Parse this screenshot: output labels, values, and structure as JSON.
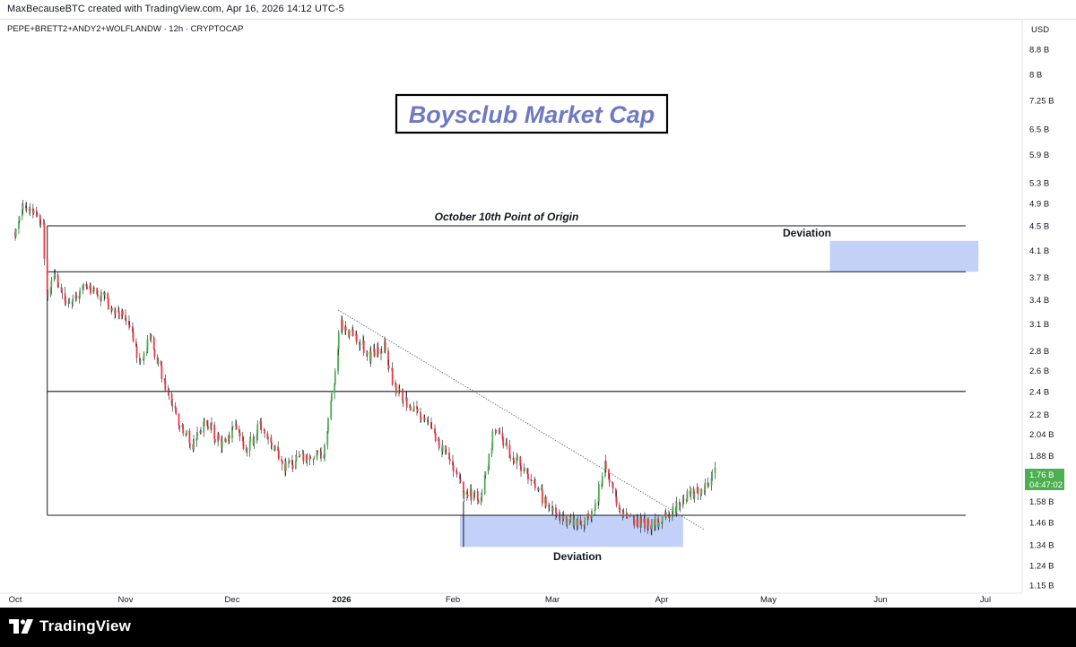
{
  "header": {
    "credit": "MaxBecauseBTC created with TradingView.com, Apr 16, 2026 14:12 UTC-5"
  },
  "chart": {
    "symbol_line": "PEPE+BRETT2+ANDY2+WOLFLANDW · 12h · CRYPTOCAP",
    "title": "Boysclub Market Cap",
    "annotation_origin": "October 10th Point of Origin",
    "annotation_deviation_top": "Deviation",
    "annotation_deviation_bottom": "Deviation",
    "currency": "USD",
    "price_badge": "1.76 B",
    "countdown": "04:47:02",
    "colors": {
      "up": "#4caf50",
      "down": "#f23645",
      "badge": "#4caf50",
      "deviation_box": "#b8c9f8",
      "title_text": "#6e79c2"
    }
  },
  "footer": {
    "brand": "TradingView"
  },
  "chart_data": {
    "type": "candlestick",
    "scale": "log",
    "y_axis_label": "USD",
    "y_tick_labels": [
      "8.8 B",
      "8 B",
      "7.25 B",
      "6.5 B",
      "5.9 B",
      "5.3 B",
      "4.9 B",
      "4.5 B",
      "4.1 B",
      "3.7 B",
      "3.4 B",
      "3.1 B",
      "2.8 B",
      "2.6 B",
      "2.4 B",
      "2.2 B",
      "2.04 B",
      "1.88 B",
      "1.58 B",
      "1.46 B",
      "1.34 B",
      "1.24 B",
      "1.15 B"
    ],
    "y_tick_values": [
      8.8,
      8.0,
      7.25,
      6.5,
      5.9,
      5.3,
      4.9,
      4.5,
      4.1,
      3.7,
      3.4,
      3.1,
      2.8,
      2.6,
      2.4,
      2.2,
      2.04,
      1.88,
      1.58,
      1.46,
      1.34,
      1.24,
      1.15
    ],
    "x_tick_labels": [
      "Oct",
      "Nov",
      "Dec",
      "2026",
      "Feb",
      "Mar",
      "Apr",
      "May",
      "Jun",
      "Jul"
    ],
    "x_tick_dates": [
      "2025-10-01",
      "2025-11-01",
      "2025-12-01",
      "2026-01-01",
      "2026-02-01",
      "2026-03-01",
      "2026-04-01",
      "2026-05-01",
      "2026-06-01",
      "2026-07-01"
    ],
    "ylim": [
      1.14,
      9.3
    ],
    "last_price": 1.76,
    "horizontal_levels": [
      {
        "value": 4.5,
        "from": "2025-10-10"
      },
      {
        "value": 3.78,
        "from": "2025-10-10"
      },
      {
        "value": 2.4,
        "from": "2025-10-10"
      },
      {
        "value": 1.5,
        "from": "2025-10-10"
      }
    ],
    "trendline": {
      "from": {
        "date": "2025-12-31",
        "value": 3.27
      },
      "to": {
        "date": "2026-04-13",
        "value": 1.42
      }
    },
    "deviation_zones": [
      {
        "from": "2026-05-18",
        "to": "2026-06-29",
        "low": 3.78,
        "high": 4.25
      },
      {
        "from": "2026-02-03",
        "to": "2026-04-07",
        "low": 1.33,
        "high": 1.5
      }
    ],
    "close_path": [
      [
        "2025-10-01",
        4.4
      ],
      [
        "2025-10-03",
        4.75
      ],
      [
        "2025-10-05",
        4.85
      ],
      [
        "2025-10-07",
        4.65
      ],
      [
        "2025-10-09",
        4.55
      ],
      [
        "2025-10-10",
        3.4
      ],
      [
        "2025-10-12",
        3.75
      ],
      [
        "2025-10-16",
        3.3
      ],
      [
        "2025-10-20",
        3.55
      ],
      [
        "2025-10-26",
        3.45
      ],
      [
        "2025-10-29",
        3.25
      ],
      [
        "2025-11-02",
        3.15
      ],
      [
        "2025-11-05",
        2.65
      ],
      [
        "2025-11-08",
        2.95
      ],
      [
        "2025-11-12",
        2.5
      ],
      [
        "2025-11-16",
        2.15
      ],
      [
        "2025-11-20",
        1.95
      ],
      [
        "2025-11-24",
        2.15
      ],
      [
        "2025-11-28",
        1.95
      ],
      [
        "2025-12-02",
        2.1
      ],
      [
        "2025-12-05",
        1.92
      ],
      [
        "2025-12-09",
        2.1
      ],
      [
        "2025-12-13",
        1.95
      ],
      [
        "2025-12-16",
        1.8
      ],
      [
        "2025-12-20",
        1.85
      ],
      [
        "2025-12-27",
        1.9
      ],
      [
        "2025-12-30",
        2.5
      ],
      [
        "2026-01-01",
        3.1
      ],
      [
        "2026-01-05",
        2.95
      ],
      [
        "2026-01-09",
        2.75
      ],
      [
        "2026-01-13",
        2.85
      ],
      [
        "2026-01-16",
        2.45
      ],
      [
        "2026-01-20",
        2.25
      ],
      [
        "2026-01-24",
        2.2
      ],
      [
        "2026-01-28",
        2.0
      ],
      [
        "2026-02-01",
        1.82
      ],
      [
        "2026-02-04",
        1.65
      ],
      [
        "2026-02-09",
        1.6
      ],
      [
        "2026-02-13",
        2.1
      ],
      [
        "2026-02-17",
        1.9
      ],
      [
        "2026-02-21",
        1.8
      ],
      [
        "2026-02-26",
        1.62
      ],
      [
        "2026-03-02",
        1.5
      ],
      [
        "2026-03-08",
        1.45
      ],
      [
        "2026-03-13",
        1.5
      ],
      [
        "2026-03-16",
        1.82
      ],
      [
        "2026-03-20",
        1.52
      ],
      [
        "2026-03-24",
        1.47
      ],
      [
        "2026-03-30",
        1.45
      ],
      [
        "2026-04-03",
        1.5
      ],
      [
        "2026-04-07",
        1.6
      ],
      [
        "2026-04-12",
        1.65
      ],
      [
        "2026-04-16",
        1.76
      ]
    ]
  }
}
